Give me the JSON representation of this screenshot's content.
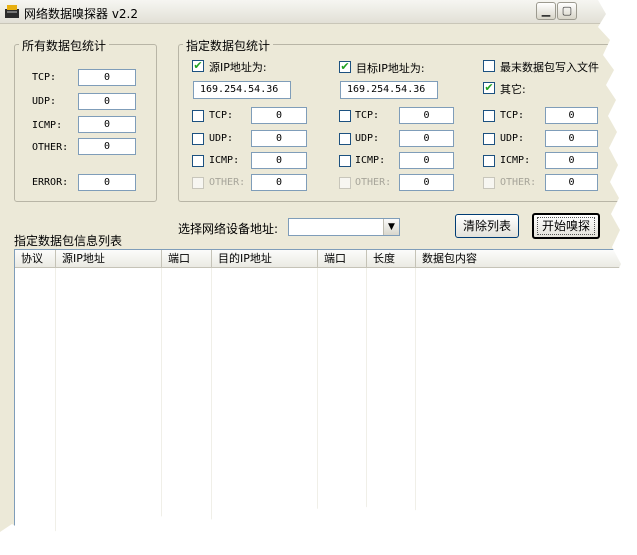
{
  "window": {
    "title": "网络数据嗅探器 v2.2",
    "minimize_icon": "minimize-icon",
    "maximize_icon": "maximize-icon"
  },
  "all_stats": {
    "legend": "所有数据包统计",
    "rows": [
      {
        "label": "TCP:",
        "value": "0"
      },
      {
        "label": "UDP:",
        "value": "0"
      },
      {
        "label": "ICMP:",
        "value": "0"
      },
      {
        "label": "OTHER:",
        "value": "0"
      }
    ],
    "error": {
      "label": "ERROR:",
      "value": "0"
    }
  },
  "filter_stats": {
    "legend": "指定数据包统计",
    "src": {
      "label": "源IP地址为:",
      "checked": true,
      "value": "169.254.54.36"
    },
    "dst": {
      "label": "目标IP地址为:",
      "checked": true,
      "value": "169.254.54.36"
    },
    "write_file": {
      "label": "最末数据包写入文件",
      "checked": false
    },
    "other": {
      "label": "其它:",
      "checked": true
    },
    "col1": [
      {
        "label": "TCP:",
        "value": "0"
      },
      {
        "label": "UDP:",
        "value": "0"
      },
      {
        "label": "ICMP:",
        "value": "0"
      },
      {
        "label": "OTHER:",
        "value": "0"
      }
    ],
    "col2": [
      {
        "label": "TCP:",
        "value": "0"
      },
      {
        "label": "UDP:",
        "value": "0"
      },
      {
        "label": "ICMP:",
        "value": "0"
      },
      {
        "label": "OTHER:",
        "value": "0"
      }
    ],
    "col3": [
      {
        "label": "TCP:",
        "value": "0"
      },
      {
        "label": "UDP:",
        "value": "0"
      },
      {
        "label": "ICMP:",
        "value": "0"
      },
      {
        "label": "OTHER:",
        "value": "0"
      }
    ]
  },
  "device": {
    "label": "选择网络设备地址:",
    "selected": ""
  },
  "buttons": {
    "clear": "清除列表",
    "start": "开始嗅探"
  },
  "list": {
    "title": "指定数据包信息列表",
    "columns": [
      "协议",
      "源IP地址",
      "端口",
      "目的IP地址",
      "端口",
      "长度",
      "数据包内容"
    ]
  },
  "colors": {
    "window_bg": "#ece9d8",
    "checkmark": "#21a121",
    "field_border": "#7f9db9"
  }
}
